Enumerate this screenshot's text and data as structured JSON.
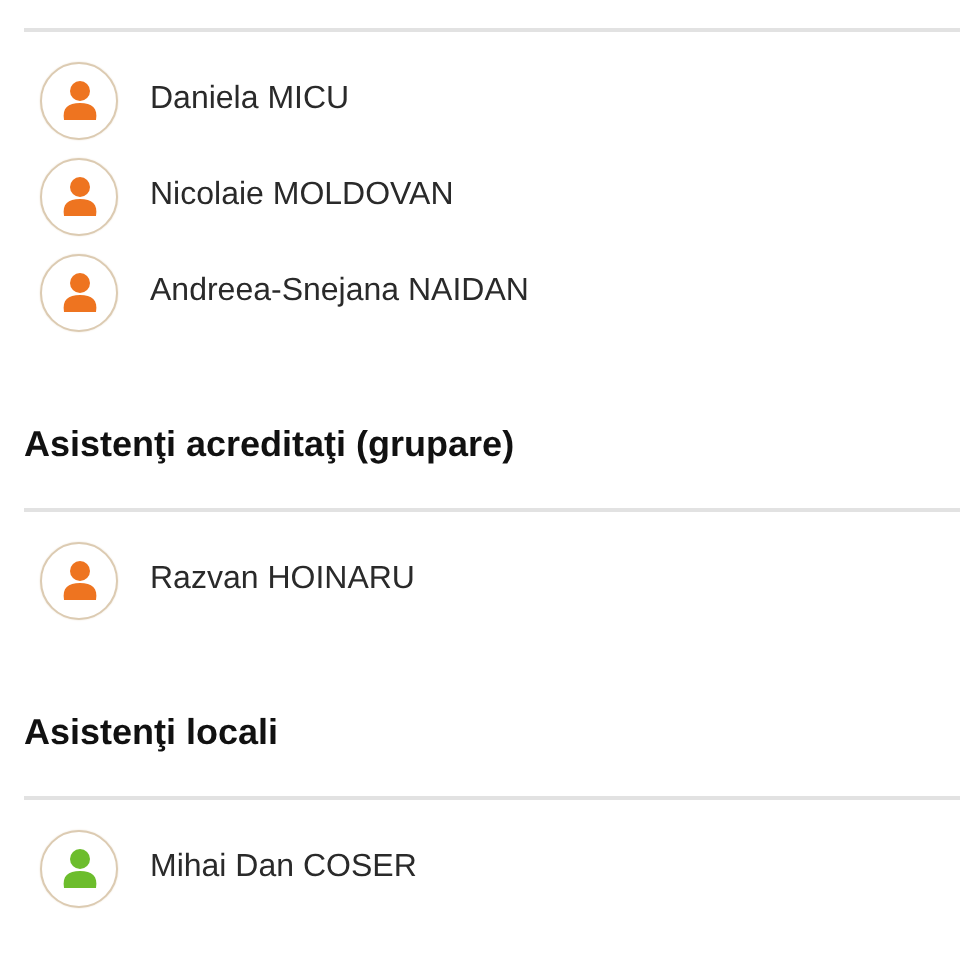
{
  "sections": [
    {
      "people": [
        {
          "name": "Daniela MICU",
          "color": "#ee7420"
        },
        {
          "name": "Nicolaie MOLDOVAN",
          "color": "#ee7420"
        },
        {
          "name": "Andreea-Snejana NAIDAN",
          "color": "#ee7420"
        }
      ]
    },
    {
      "heading": "Asistenţi acreditaţi (grupare)",
      "people": [
        {
          "name": "Razvan HOINARU",
          "color": "#ee7420"
        }
      ]
    },
    {
      "heading": "Asistenţi locali",
      "people": [
        {
          "name": "Mihai Dan COSER",
          "color": "#6cbd2c"
        }
      ]
    }
  ]
}
